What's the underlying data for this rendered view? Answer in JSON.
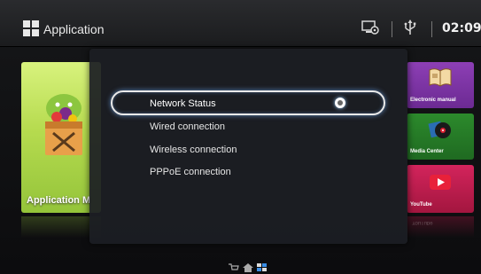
{
  "header": {
    "title": "Application",
    "clock": "02:09",
    "icons": [
      "apps-grid-icon",
      "screen-settings-icon",
      "usb-icon"
    ]
  },
  "tiles": {
    "application_label": "Application M",
    "electronic_manual": "Electronic manual",
    "media_center": "Media Center",
    "youtube": "YouTube",
    "youtube_reflection": "YouTube"
  },
  "menu": {
    "items": [
      {
        "label": "Network Status",
        "selected": true
      },
      {
        "label": "Wired connection",
        "selected": false
      },
      {
        "label": "Wireless connection",
        "selected": false
      },
      {
        "label": "PPPoE connection",
        "selected": false
      }
    ]
  },
  "colors": {
    "tile_application": "#b6db4f",
    "tile_electronic_manual": "#7b33a5",
    "tile_media_center": "#25792a",
    "tile_youtube": "#c21f50",
    "selection_border": "#eaeaea"
  },
  "bottom_bar": {
    "icons": [
      "cart-icon",
      "home-icon",
      "grid-icon"
    ]
  }
}
